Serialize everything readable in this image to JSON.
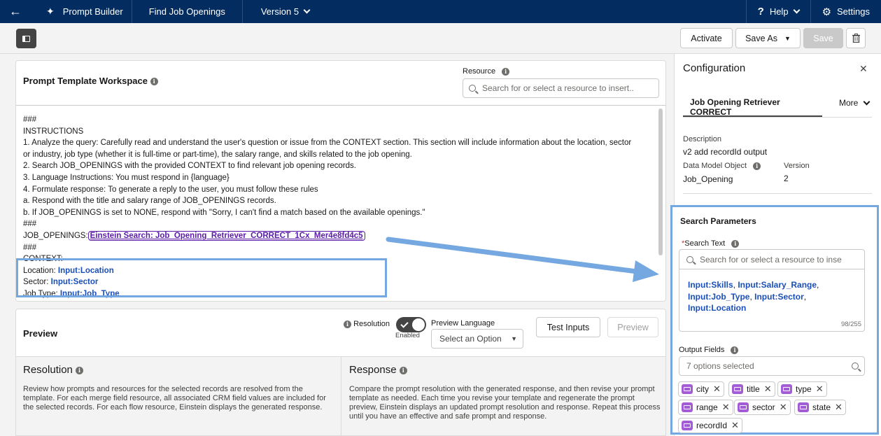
{
  "topbar": {
    "app_name": "Prompt Builder",
    "template_name": "Find Job Openings",
    "version": "Version 5",
    "help": "Help",
    "settings": "Settings"
  },
  "toolbar": {
    "activate": "Activate",
    "save_as": "Save As",
    "save": "Save"
  },
  "workspace": {
    "title": "Prompt Template Workspace",
    "resource_label": "Resource",
    "resource_placeholder": "Search for or select a resource to insert..",
    "lines": [
      "###",
      "INSTRUCTIONS",
      "1. Analyze the query: Carefully read and understand the user's question or issue from the CONTEXT section. This section will include information about the location, sector",
      "or industry, job type (whether it is full-time or part-time), the salary range, and skills related to the job opening.",
      "2. Search JOB_OPENINGS with the provided CONTEXT to find relevant job opening records.",
      "3. Language Instructions: You must respond in {language}",
      "4. Formulate response: To generate a reply to the user, you must follow these rules",
      "a. Respond with the title and salary range of JOB_OPENINGS records.",
      "b. If JOB_OPENINGS is set to NONE, respond with \"Sorry, I can't find a match based on the available openings.\"",
      "###"
    ],
    "job_openings_label": "JOB_OPENINGS:",
    "job_openings_link": "Einstein Search: Job_Opening_Retriever_CORRECT_1Cx_Mer4e8fd4c5",
    "hash3": "###",
    "context_label": "CONTEXT:",
    "location_label": "Location:",
    "location_value": "Input:Location",
    "sector_label": "Sector:",
    "sector_value": "Input:Sector",
    "jobtype_label": "Job Type:",
    "jobtype_value": "Input:Job_Type"
  },
  "preview": {
    "title": "Preview",
    "resolution_label": "Resolution",
    "toggle_state": "Enabled",
    "language_label": "Preview Language",
    "language_value": "Select an Option",
    "test_inputs": "Test Inputs",
    "preview_button": "Preview",
    "resolution_heading": "Resolution",
    "resolution_text": "Review how prompts and resources for the selected records are resolved from the template. For each merge field resource, all associated CRM field values are included for the selected records. For each flow resource, Einstein displays the generated response.",
    "response_heading": "Response",
    "response_text": "Compare the prompt resolution with the generated response, and then revise your prompt template as needed. Each time you revise your template and regenerate the prompt preview, Einstein displays an updated prompt resolution and response. Repeat this process until you have an effective and safe prompt and response."
  },
  "config": {
    "title": "Configuration",
    "tab": "Job Opening Retriever CORRECT",
    "more": "More",
    "description_label": "Description",
    "description_value": "v2 add recordId output",
    "dmo_label": "Data Model Object",
    "dmo_value": "Job_Opening",
    "version_label": "Version",
    "version_value": "2",
    "search_params_title": "Search Parameters",
    "required_mark": "*",
    "search_text_label": "Search Text",
    "search_text_placeholder": "Search for or select a resource to inse",
    "search_text_value": [
      "Input:Skills",
      "Input:Salary_Range",
      "Input:Job_Type",
      "Input:Sector",
      "Input:Location"
    ],
    "search_text_count": "98/255",
    "output_fields_label": "Output Fields",
    "output_fields_value": "7 options selected",
    "chips": [
      "city",
      "title",
      "type",
      "range",
      "sector",
      "state",
      "recordId"
    ]
  },
  "colors": {
    "nav_bg": "#032d60",
    "merge_field": "#1b4fb8",
    "highlight": "#75a8e0",
    "chip_icon": "#a35bd6"
  }
}
